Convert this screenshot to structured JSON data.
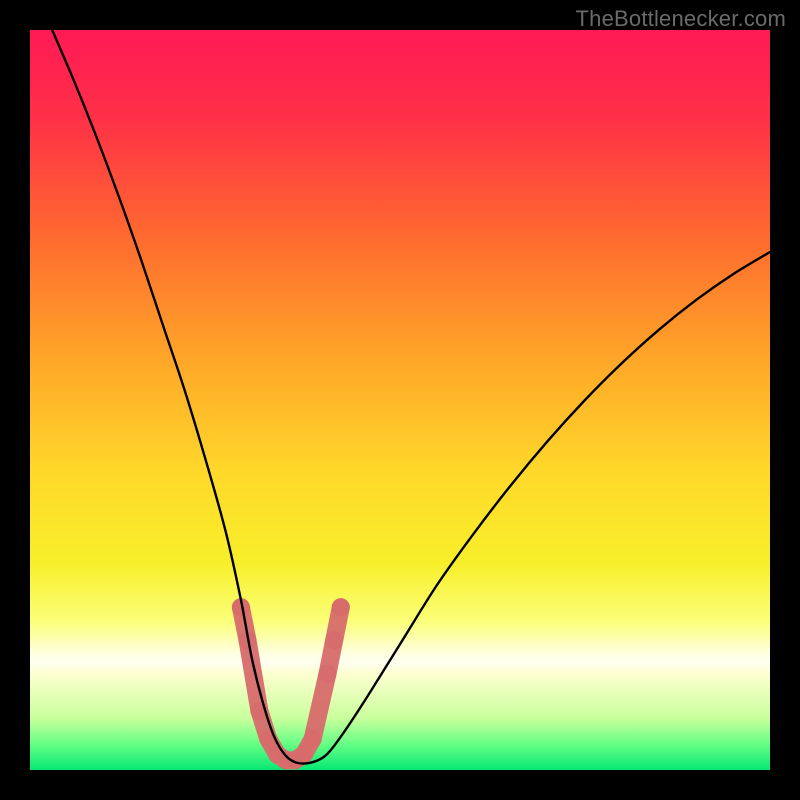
{
  "watermark": "TheBottlenecker.com",
  "chart_data": {
    "type": "line",
    "title": "",
    "xlabel": "",
    "ylabel": "",
    "xlim": [
      0,
      100
    ],
    "ylim": [
      0,
      100
    ],
    "background_gradient_stops": [
      {
        "offset": 0,
        "color": "#ff1a55"
      },
      {
        "offset": 0.12,
        "color": "#ff3047"
      },
      {
        "offset": 0.28,
        "color": "#ff6a2f"
      },
      {
        "offset": 0.45,
        "color": "#ffa828"
      },
      {
        "offset": 0.6,
        "color": "#ffd92a"
      },
      {
        "offset": 0.72,
        "color": "#f8ef2a"
      },
      {
        "offset": 0.8,
        "color": "#fbff7a"
      },
      {
        "offset": 0.845,
        "color": "#ffffe6"
      },
      {
        "offset": 0.855,
        "color": "#fffff0"
      },
      {
        "offset": 0.87,
        "color": "#fdffd0"
      },
      {
        "offset": 0.93,
        "color": "#c9ff9c"
      },
      {
        "offset": 0.965,
        "color": "#66ff85"
      },
      {
        "offset": 1.0,
        "color": "#07e874"
      }
    ],
    "series": [
      {
        "name": "bottleneck-curve",
        "x": [
          3,
          6,
          9,
          12,
          15,
          18,
          21,
          24,
          26.5,
          28.5,
          30,
          31.5,
          33,
          34.5,
          36,
          38,
          40,
          42,
          45,
          50,
          55,
          60,
          65,
          70,
          75,
          80,
          85,
          90,
          95,
          100
        ],
        "y": [
          100,
          93,
          85.5,
          77.5,
          69,
          60,
          51,
          41,
          32,
          23,
          15,
          9,
          4.5,
          2,
          1,
          1,
          2,
          4.5,
          9,
          17,
          25,
          32,
          38.5,
          44.5,
          50,
          55,
          59.5,
          63.5,
          67,
          70
        ]
      }
    ],
    "optimum_marker": {
      "color": "#d76c6c",
      "points_x": [
        28.5,
        29.4,
        31,
        32.2,
        33.4,
        34.6,
        35.8,
        37,
        38.2,
        40.2,
        41.1,
        42
      ],
      "points_y": [
        22,
        17.5,
        8,
        4.2,
        2.1,
        1.3,
        1.3,
        2.1,
        4.2,
        13,
        17.5,
        22
      ],
      "radius": 9,
      "stroke_width": 18
    }
  }
}
